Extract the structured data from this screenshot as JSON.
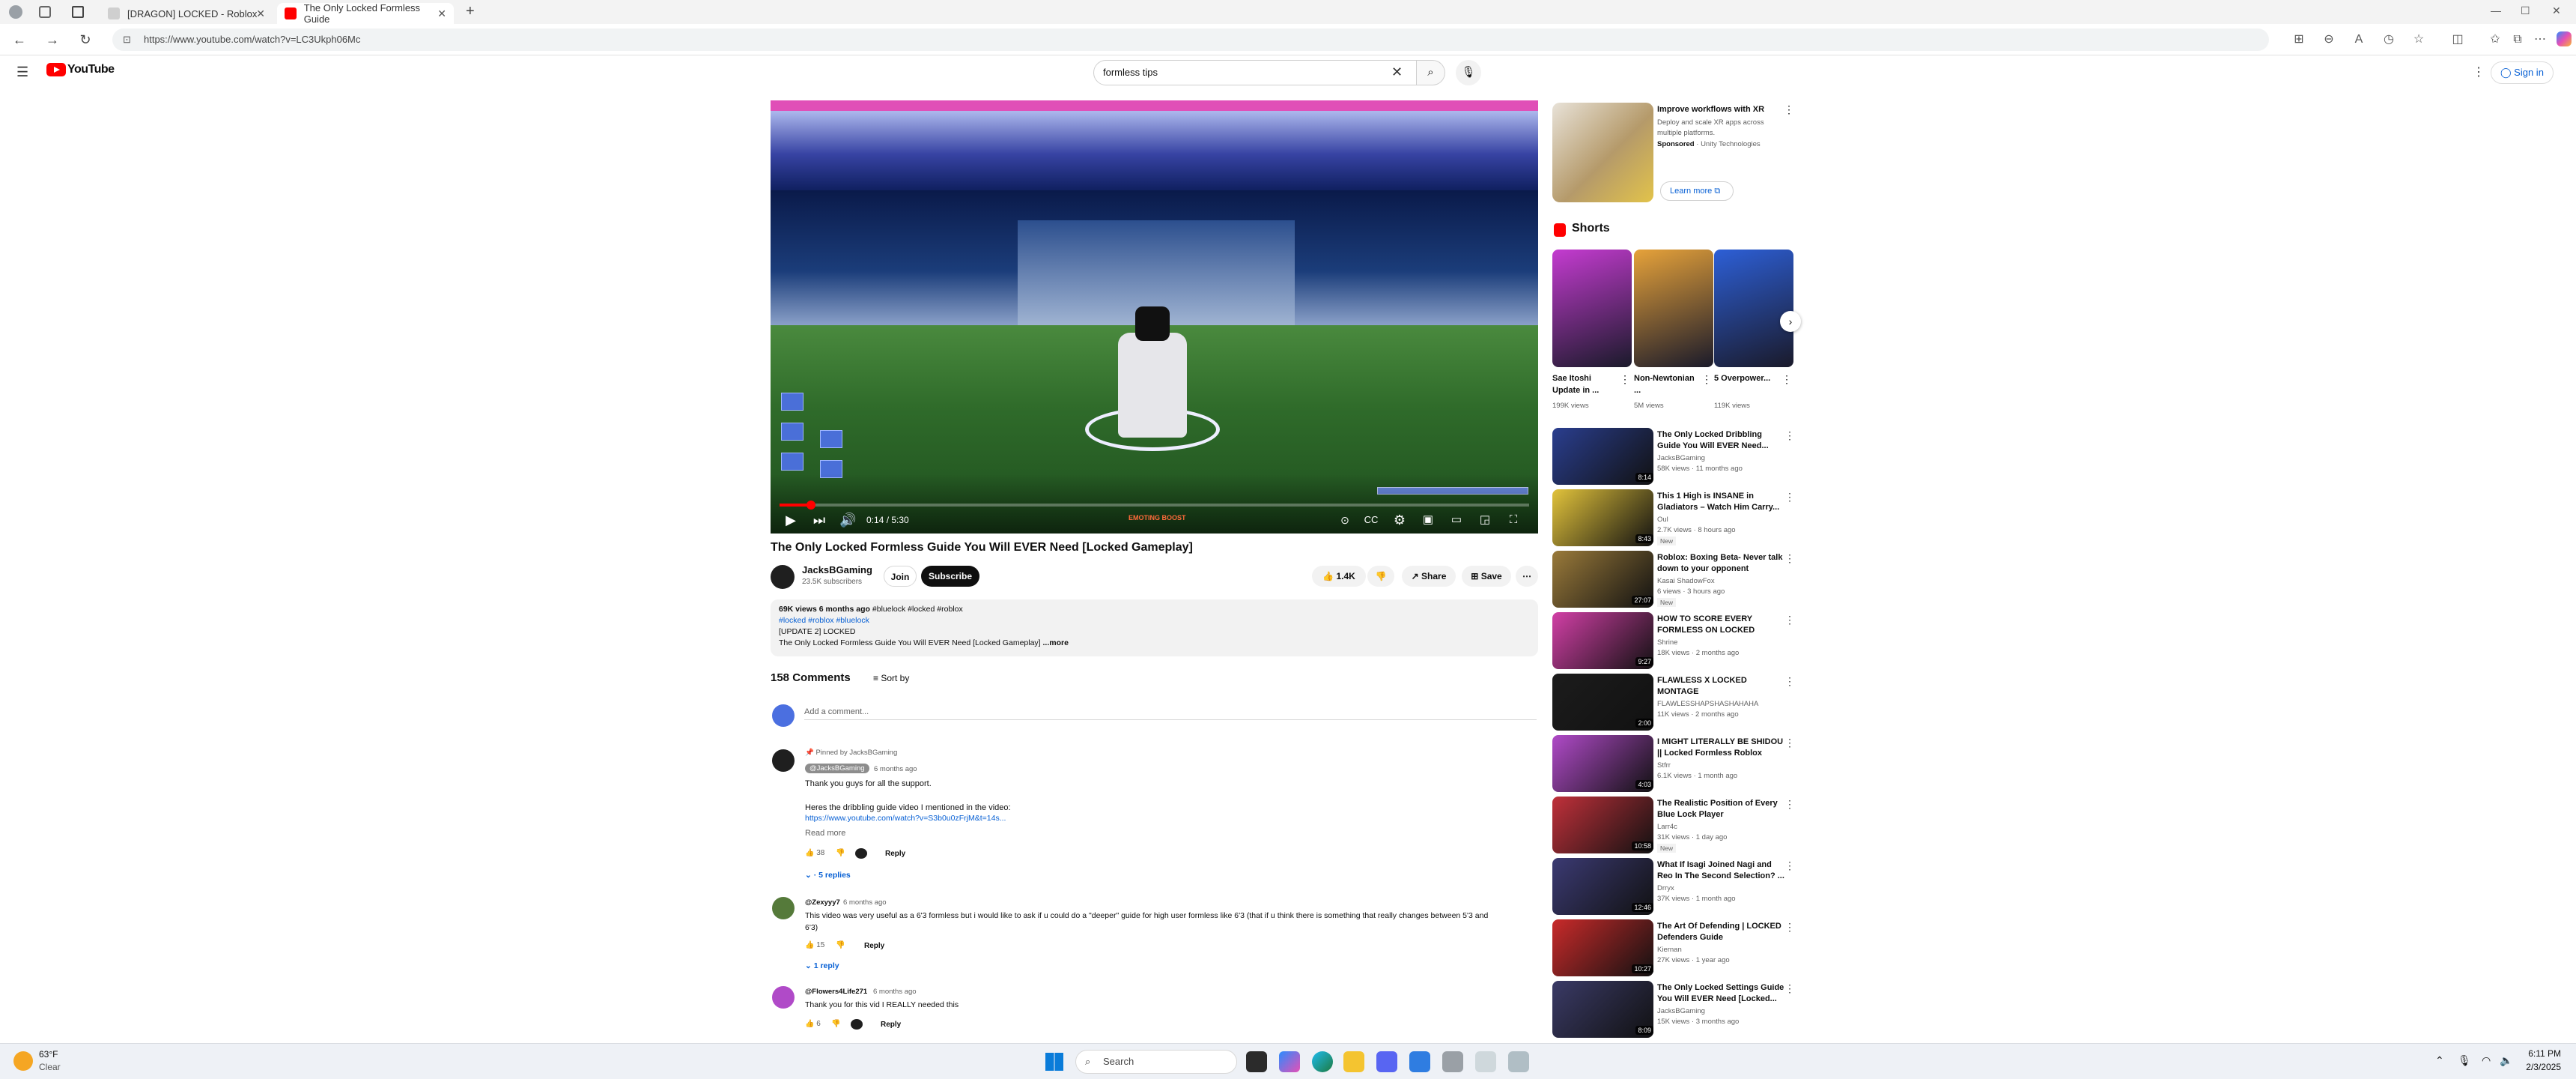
{
  "browser": {
    "tabs": [
      {
        "title": "[DRAGON] LOCKED - Roblox"
      },
      {
        "title": "The Only Locked Formless Guide"
      }
    ],
    "url": "https://www.youtube.com/watch?v=LC3Ukph06Mc"
  },
  "header": {
    "logo_text": "YouTube",
    "search_value": "formless tips",
    "sign_in": "Sign in"
  },
  "player": {
    "time": "0:14 / 5:30",
    "progress_fraction": 0.042,
    "ingame_text": "EMOTING BOOST"
  },
  "video": {
    "title": "The Only Locked Formless Guide You Will EVER Need [Locked Gameplay]",
    "channel": "JacksBGaming",
    "subscribers": "23.5K subscribers",
    "join": "Join",
    "subscribe": "Subscribe",
    "likes": "1.4K",
    "share": "Share",
    "save": "Save"
  },
  "description": {
    "meta": "69K views  6 months ago",
    "meta_tags": "#bluelock #locked #roblox",
    "tags": "#locked #roblox #bluelock",
    "line1": "[UPDATE 2] LOCKED",
    "line2": "The Only Locked Formless Guide You Will EVER Need [Locked Gameplay]",
    "more": "...more"
  },
  "comments": {
    "count": "158 Comments",
    "sort_by": "Sort by",
    "add_placeholder": "Add a comment...",
    "items": [
      {
        "pinned": "Pinned by JacksBGaming",
        "author": "@JacksBGaming",
        "time": "6 months ago",
        "line1": "Thank you guys for all the support.",
        "line2": "Heres the dribbling guide video I mentioned in the video:",
        "link": "https://www.youtube.com/watch?v=S3b0u0zFrjM&t=14s...",
        "read_more": "Read more",
        "likes": "38",
        "reply": "Reply",
        "replies": "5 replies"
      },
      {
        "author": "@Zexyyy7",
        "time": "6 months ago",
        "line1": "This video was very useful as a 6'3 formless but i would like to ask if u could do a \"deeper\" guide for high user formless like 6'3 (that if u think there is something that really changes between 5'3 and",
        "line2": "6'3)",
        "likes": "15",
        "reply": "Reply",
        "replies": "1 reply"
      },
      {
        "author": "@Flowers4Life271",
        "time": "6 months ago",
        "line1": "Thank you for this vid I REALLY needed this",
        "likes": "6",
        "reply": "Reply"
      }
    ]
  },
  "sidebar": {
    "ad": {
      "title": "Improve workflows with XR",
      "desc1": "Deploy and scale XR apps across",
      "desc2": "multiple platforms.",
      "sponsored": "Sponsored",
      "advertiser": "· Unity Technologies",
      "learn_more": "Learn more"
    },
    "shorts_title": "Shorts",
    "shorts": [
      {
        "title": "Sae Itoshi Update in ...",
        "views": "199K views",
        "color": "#c43bd0"
      },
      {
        "title": "Non-Newtonian ...",
        "views": "5M views",
        "color": "#e6a23a"
      },
      {
        "title": "5 Overpower...",
        "views": "119K views",
        "color": "#2d5fd6"
      }
    ],
    "recs": [
      {
        "title": "The Only Locked Dribbling Guide You Will EVER Need...",
        "channel": "JacksBGaming",
        "views": "58K views · 11 months ago",
        "duration": "8:14",
        "new": "",
        "color": "#2a3e8f"
      },
      {
        "title": "This 1 High is INSANE in Gladiators – Watch Him Carry...",
        "channel": "Oul",
        "views": "2.7K views · 8 hours ago",
        "duration": "8:43",
        "new": "New",
        "color": "#e2c33b"
      },
      {
        "title": "Roblox: Boxing Beta- Never talk down to your opponent",
        "channel": "Kasai ShadowFox",
        "views": "6 views · 3 hours ago",
        "duration": "27:07",
        "new": "New",
        "color": "#9a7a3a"
      },
      {
        "title": "HOW TO SCORE EVERY FORMLESS ON LOCKED",
        "channel": "Shrine",
        "views": "18K views · 2 months ago",
        "duration": "9:27",
        "new": "",
        "color": "#d23fa6"
      },
      {
        "title": "FLAWLESS X LOCKED MONTAGE",
        "channel": "FLAWLESSHAPSHASHAHAHA",
        "views": "11K views · 2 months ago",
        "duration": "2:00",
        "new": "",
        "color": "#1c1c1c"
      },
      {
        "title": "I MIGHT LITERALLY BE SHIDOU || Locked Formless Roblox",
        "channel": "Stfrr",
        "views": "6.1K views · 1 month ago",
        "duration": "4:03",
        "new": "",
        "color": "#b04ac8"
      },
      {
        "title": "The Realistic Position of Every Blue Lock Player",
        "channel": "Larr4c",
        "views": "31K views · 1 day ago",
        "duration": "10:58",
        "new": "New",
        "color": "#c0303a"
      },
      {
        "title": "What If Isagi Joined Nagi and Reo In The Second Selection? ...",
        "channel": "Drryx",
        "views": "37K views · 1 month ago",
        "duration": "12:46",
        "new": "",
        "color": "#3b3a73"
      },
      {
        "title": "The Art Of Defending | LOCKED Defenders Guide",
        "channel": "Kiernan",
        "views": "27K views · 1 year ago",
        "duration": "10:27",
        "new": "",
        "color": "#c92a2a"
      },
      {
        "title": "The Only Locked Settings Guide You Will EVER Need [Locked...",
        "channel": "JacksBGaming",
        "views": "15K views · 3 months ago",
        "duration": "8:09",
        "new": "",
        "color": "#3a3a66"
      }
    ]
  },
  "taskbar": {
    "weather_temp": "63°F",
    "weather_cond": "Clear",
    "search": "Search",
    "time": "6:11 PM",
    "date": "2/3/2025"
  }
}
